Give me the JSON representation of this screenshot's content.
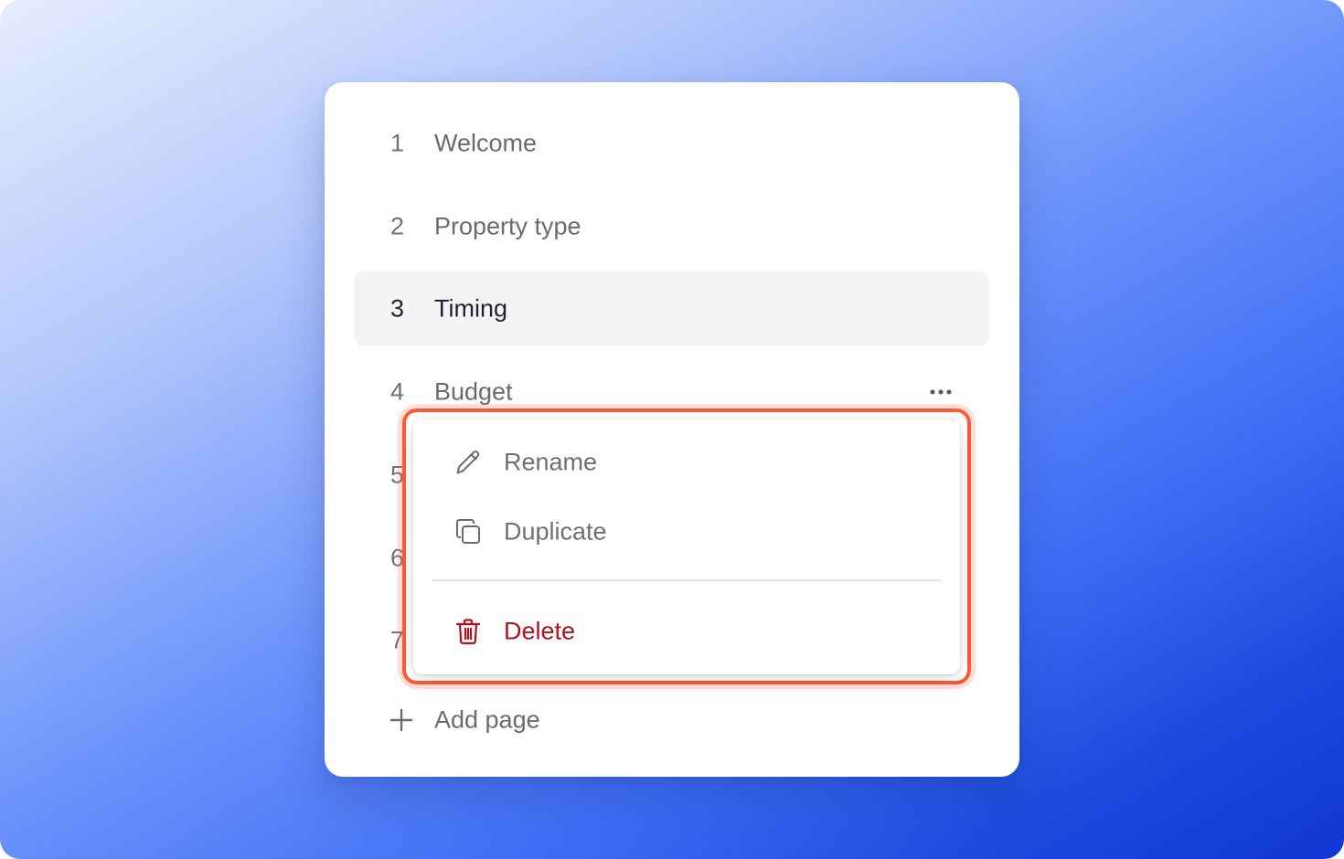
{
  "pages": [
    {
      "number": "1",
      "label": "Welcome",
      "selected": false
    },
    {
      "number": "2",
      "label": "Property type",
      "selected": false
    },
    {
      "number": "3",
      "label": "Timing",
      "selected": true
    },
    {
      "number": "4",
      "label": "Budget",
      "selected": false
    },
    {
      "number": "5",
      "label": "",
      "selected": false
    },
    {
      "number": "6",
      "label": "",
      "selected": false
    },
    {
      "number": "7",
      "label": "",
      "selected": false
    }
  ],
  "add_page": {
    "label": "Add page",
    "icon": "plus-icon"
  },
  "context_menu": {
    "rename": {
      "label": "Rename",
      "icon": "pencil-icon"
    },
    "duplicate": {
      "label": "Duplicate",
      "icon": "duplicate-icon"
    },
    "delete": {
      "label": "Delete",
      "icon": "trash-icon"
    }
  },
  "colors": {
    "highlight_outline": "#ff5a36",
    "danger": "#b3101e",
    "selected_row_bg": "#f4f4f5",
    "muted_text": "#707070"
  }
}
